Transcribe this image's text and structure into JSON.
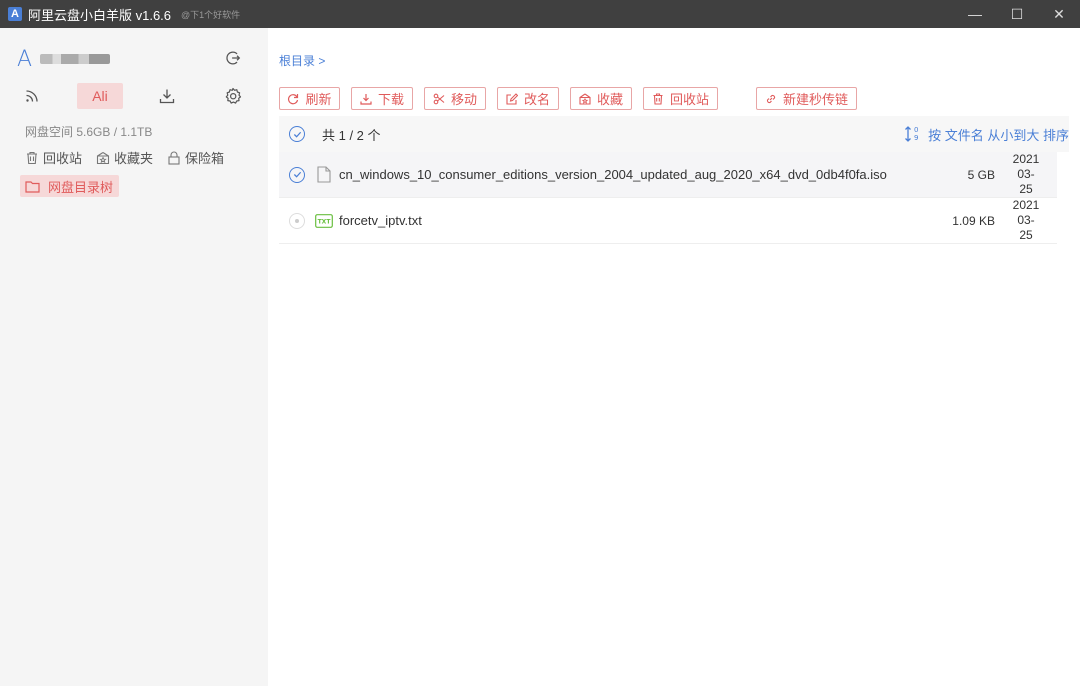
{
  "titlebar": {
    "app_icon_letter": "A",
    "title": "阿里云盘小白羊版 v1.6.6",
    "watermark": "@下1个好软件",
    "minimize": "—",
    "maximize": "☐",
    "close": "✕"
  },
  "sidebar": {
    "account_logo": "A",
    "nav": {
      "ali": "Ali"
    },
    "storage": "网盘空间 5.6GB / 1.1TB",
    "quick_links": [
      {
        "label": "回收站",
        "icon": "trash-icon"
      },
      {
        "label": "收藏夹",
        "icon": "star-icon"
      },
      {
        "label": "保险箱",
        "icon": "lock-icon"
      }
    ],
    "tree": {
      "label": "网盘目录树",
      "icon": "folder-icon"
    }
  },
  "main": {
    "breadcrumb": "根目录 >",
    "toolbar": [
      {
        "label": "刷新",
        "icon": "refresh-icon"
      },
      {
        "label": "下载",
        "icon": "download-icon"
      },
      {
        "label": "移动",
        "icon": "scissors-icon"
      },
      {
        "label": "改名",
        "icon": "edit-icon"
      },
      {
        "label": "收藏",
        "icon": "star-icon"
      },
      {
        "label": "回收站",
        "icon": "trash-icon"
      },
      {
        "label": "新建秒传链",
        "icon": "link-icon"
      }
    ],
    "list_header": {
      "count": "共 1 / 2 个",
      "sort": "按 文件名 从小到大 排序"
    },
    "files": [
      {
        "name": "cn_windows_10_consumer_editions_version_2004_updated_aug_2020_x64_dvd_0db4f0fa.iso",
        "size": "5 GB",
        "date_year": "2021",
        "date_md": "03-25",
        "selected": true,
        "icon": "file-icon"
      },
      {
        "name": "forcetv_iptv.txt",
        "size": "1.09 KB",
        "date_year": "2021",
        "date_md": "03-25",
        "selected": false,
        "icon": "txt-file-icon"
      }
    ]
  },
  "colors": {
    "accent_blue": "#4a7fd6",
    "accent_red": "#e05b5b",
    "titlebar_bg": "#404040",
    "sidebar_bg": "#f5f5f5"
  }
}
